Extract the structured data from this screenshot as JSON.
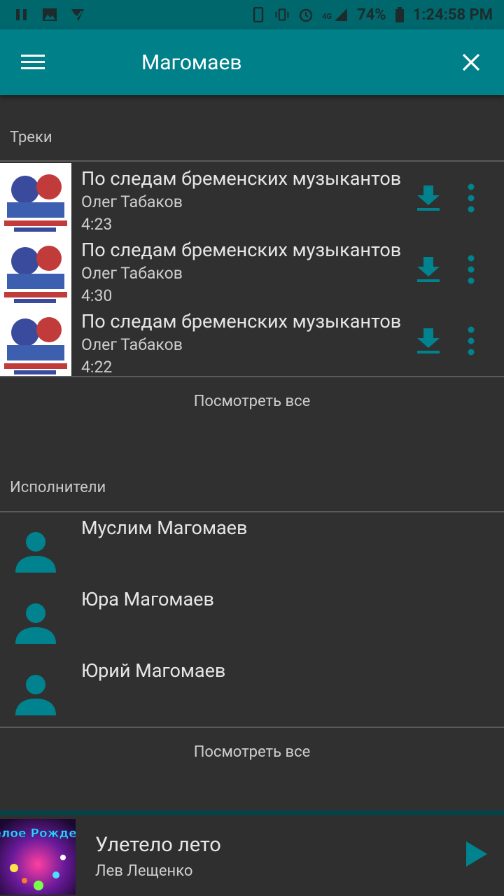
{
  "status": {
    "network": "4G",
    "battery": "74%",
    "time": "1:24:58 PM"
  },
  "appbar": {
    "title": "Магомаев",
    "menu_icon": "hamburger-menu-icon",
    "close_icon": "close-icon"
  },
  "tracks": {
    "header": "Треки",
    "items": [
      {
        "title": "По следам бременских музыкантов",
        "artist": "Олег Табаков",
        "duration": "4:23"
      },
      {
        "title": "По следам бременских музыкантов",
        "artist": "Олег Табаков",
        "duration": "4:30"
      },
      {
        "title": "По следам бременских музыкантов",
        "artist": "Олег Табаков",
        "duration": "4:22"
      }
    ],
    "see_all": "Посмотреть все"
  },
  "artists": {
    "header": "Исполнители",
    "items": [
      {
        "name": "Муслим Магомаев"
      },
      {
        "name": "Юра Магомаев"
      },
      {
        "name": "Юрий Магомаев"
      }
    ],
    "see_all": "Посмотреть все"
  },
  "player": {
    "title": "Улетело лето",
    "artist": "Лев Лещенко",
    "cover_text": "Весёлое Рождество"
  },
  "colors": {
    "accent": "#008089",
    "icon_teal": "#00838f",
    "background": "#303030"
  }
}
